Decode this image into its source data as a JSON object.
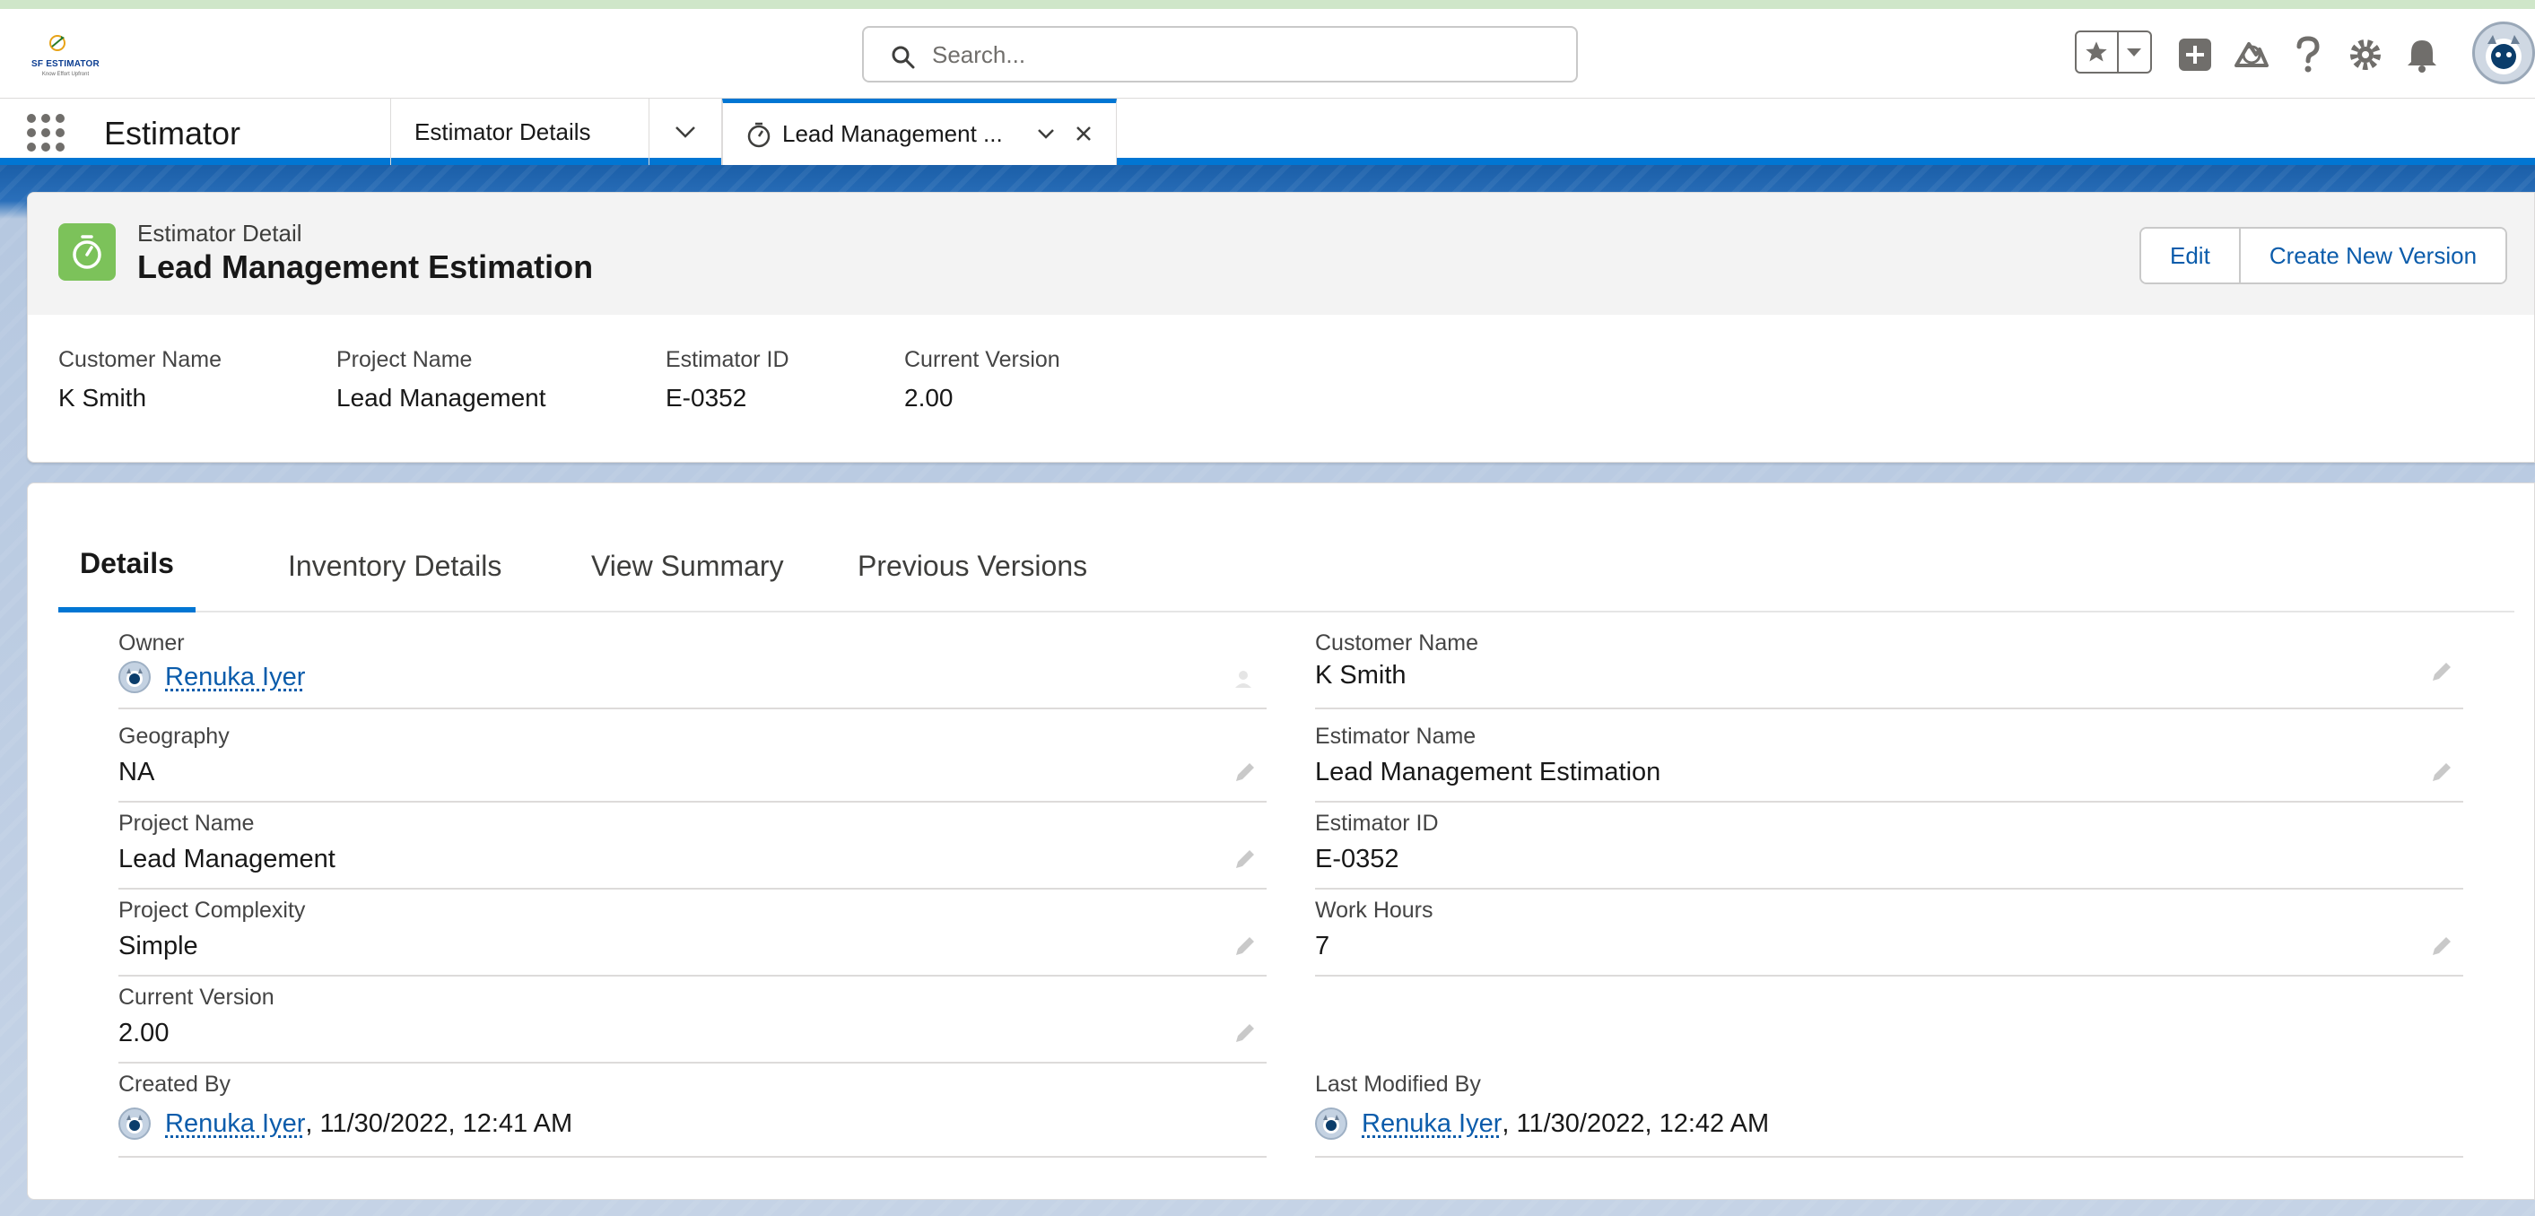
{
  "header": {
    "logo_text": "SF ESTIMATOR",
    "logo_tagline": "Know Effort Upfront",
    "search_placeholder": "Search..."
  },
  "nav": {
    "app_name": "Estimator",
    "tabs": [
      {
        "label": "Estimator Details"
      },
      {
        "label": "Lead Management ..."
      }
    ]
  },
  "record": {
    "type_label": "Estimator Detail",
    "title": "Lead Management Estimation",
    "actions": {
      "edit": "Edit",
      "create_new_version": "Create New Version"
    },
    "highlights": [
      {
        "label": "Customer Name",
        "value": "K Smith"
      },
      {
        "label": "Project Name",
        "value": "Lead Management"
      },
      {
        "label": "Estimator ID",
        "value": "E-0352"
      },
      {
        "label": "Current Version",
        "value": "2.00"
      }
    ],
    "icon_color": "#7cc25a"
  },
  "tabs": [
    {
      "label": "Details",
      "active": true
    },
    {
      "label": "Inventory Details",
      "active": false
    },
    {
      "label": "View Summary",
      "active": false
    },
    {
      "label": "Previous Versions",
      "active": false
    }
  ],
  "details": {
    "left": [
      {
        "label": "Owner",
        "value": "Renuka Iyer"
      },
      {
        "label": "Geography",
        "value": "NA"
      },
      {
        "label": "Project Name",
        "value": "Lead Management"
      },
      {
        "label": "Project Complexity",
        "value": "Simple"
      },
      {
        "label": "Current Version",
        "value": "2.00"
      },
      {
        "label": "Created By",
        "user": "Renuka Iyer",
        "date": ", 11/30/2022, 12:41 AM"
      }
    ],
    "right": [
      {
        "label": "Customer Name",
        "value": "K Smith"
      },
      {
        "label": "Estimator Name",
        "value": "Lead Management Estimation"
      },
      {
        "label": "Estimator ID",
        "value": "E-0352"
      },
      {
        "label": "Work Hours",
        "value": "7"
      },
      {
        "label": "Last Modified By",
        "user": "Renuka Iyer",
        "date": ", 11/30/2022, 12:42 AM"
      }
    ]
  },
  "colors": {
    "brand_blue": "#0176d3",
    "link": "#0b5cab",
    "icon_green": "#7cc25a"
  }
}
